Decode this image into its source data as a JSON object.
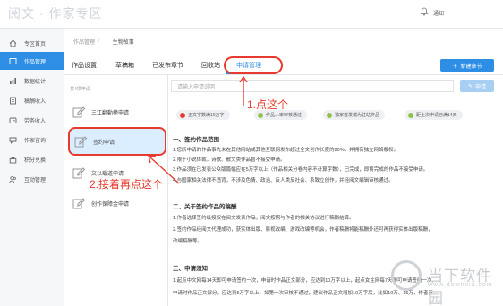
{
  "header": {
    "brand": "阅文 · 作家专区",
    "notify_label": "通知"
  },
  "sidebar": {
    "items": [
      {
        "label": "专区首页",
        "icon": "home-icon"
      },
      {
        "label": "作品管理",
        "icon": "book-icon",
        "active": true
      },
      {
        "label": "数据统计",
        "icon": "bar-chart-icon"
      },
      {
        "label": "稿酬收入",
        "icon": "document-icon"
      },
      {
        "label": "劳务收入",
        "icon": "wallet-icon"
      },
      {
        "label": "作家咨询",
        "icon": "chat-icon"
      },
      {
        "label": "积分兑换",
        "icon": "gift-icon"
      },
      {
        "label": "互动管理",
        "icon": "people-icon"
      }
    ]
  },
  "breadcrumb": [
    "作品管理",
    "生物故事"
  ],
  "tabs": [
    "作品设置",
    "草稿箱",
    "已发布章节",
    "回收站",
    "申请管理"
  ],
  "new_button": "新建章节",
  "search": {
    "placeholder": "请输入申请说明",
    "apply_label": "申请"
  },
  "list": {
    "count": "共4项申请",
    "items": [
      "三江翻動榜申请",
      "签约申请",
      "文以载道申请",
      "创作保障金申请"
    ]
  },
  "pills": [
    "正文字数满10万字",
    "作品人审审核通过",
    "独家首发或为驻站作品",
    "距上次申请已满14天"
  ],
  "content": {
    "s1_title": "一、签约作品范围",
    "s1_p1": "1.您所申请的作品事先未在其他网站或其他互联网发布超过全文创作长度的20%，并拥有独立网络版权。",
    "s1_p2": "2.限于小说体裁，诗歌、散文类作品暂不接受申请。",
    "s1_p3": "3.作品须在已发表公众版篇幅应在5万字以上（作品相关分卷内容不计算字数），已完成，即将完成的作品不接受申请。",
    "s1_p4": "4.与国家相关法律不违背，不涉及色情、政治、反人类反社会、系致立创作，并经阅文编辑审核通过。",
    "s2_title": "二、关于签约作品的稿酬",
    "s2_p1": "1.作者选择签约级授权在阅文发表作品，阅文按照与作者的相关协议进行稿酬结算。",
    "s2_p2": "2.签约作品经阅文代理成功，获实体出版、影视改编、游戏改编等机会，作者稿酬将能稿酬外还可再获得实体出版稿酬，",
    "s2_p3": "改编稿酬等。",
    "s3_title": "三、申请须知",
    "s3_p1": "1.起点中文网每14天即可申请签约一次，申请时作品正文部分，应达到10万字以上，起点女生网每7天即可申请签约一次，",
    "s3_p2": "申请时作品正文部分，应达到5万字以上，如第一次审核不通过，建议作品正文增加10万字后，比如10万、15万，作者再"
  },
  "annotations": {
    "step1": "1.点这个",
    "step2": "2.接着再点这个"
  },
  "watermark": {
    "cn": "当下软件园",
    "en": "www.downxia.com"
  },
  "colors": {
    "accent": "#2e8ee6",
    "annotation": "#e63b2e"
  }
}
